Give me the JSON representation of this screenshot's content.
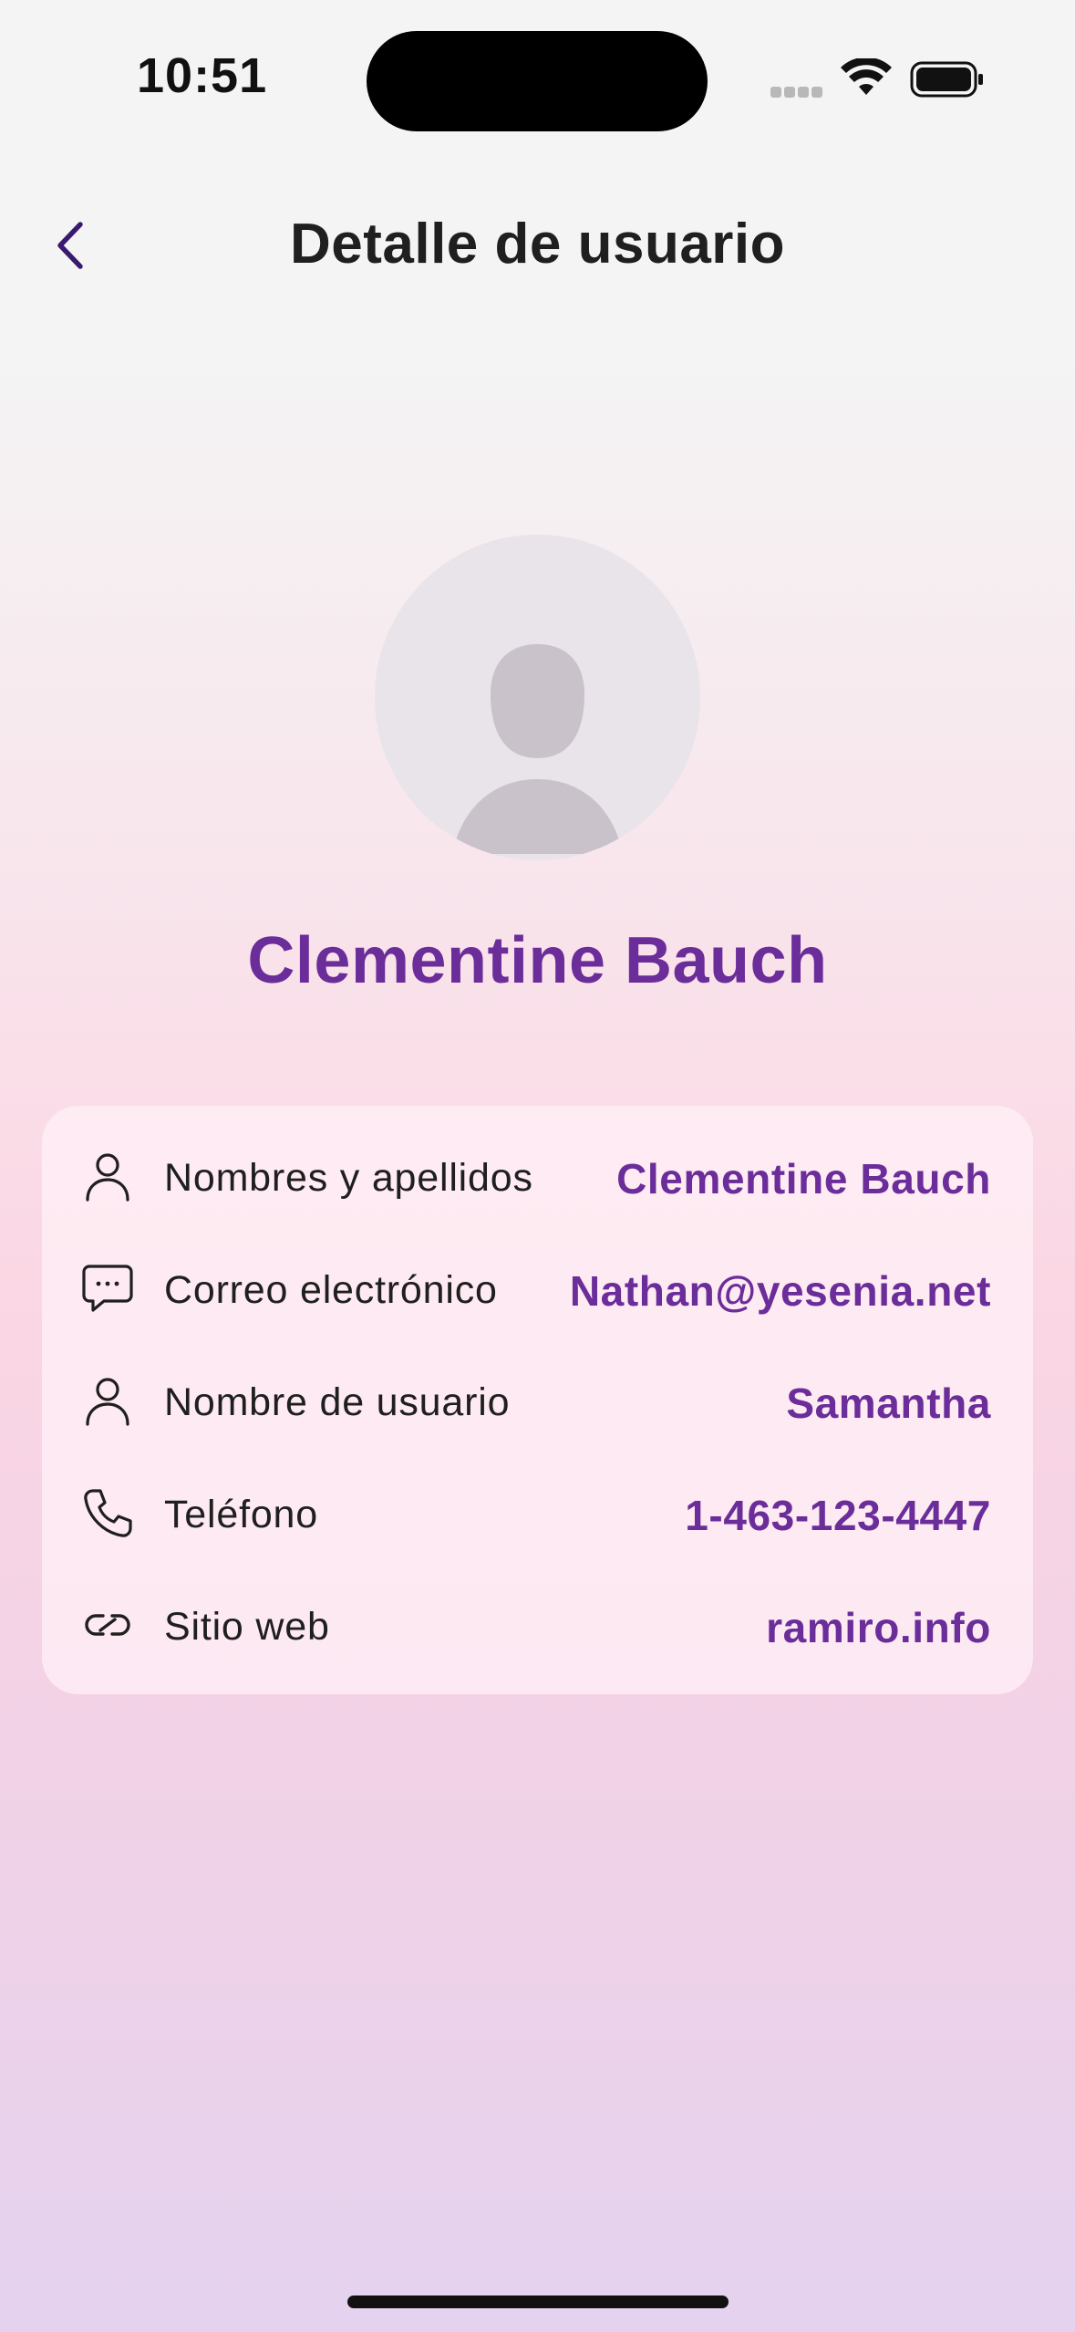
{
  "status_bar": {
    "time": "10:51",
    "icons": [
      "signal-icon",
      "wifi-icon",
      "battery-icon"
    ]
  },
  "nav": {
    "title": "Detalle de usuario",
    "back_icon": "chevron-left-icon"
  },
  "profile": {
    "name": "Clementine Bauch",
    "avatar_icon": "person-placeholder-icon"
  },
  "details": [
    {
      "icon": "person-icon",
      "label": "Nombres y apellidos",
      "value": "Clementine Bauch"
    },
    {
      "icon": "chat-bubble-icon",
      "label": "Correo electrónico",
      "value": "Nathan@yesenia.net"
    },
    {
      "icon": "person-icon",
      "label": "Nombre de usuario",
      "value": "Samantha"
    },
    {
      "icon": "phone-icon",
      "label": "Teléfono",
      "value": "1-463-123-4447"
    },
    {
      "icon": "link-icon",
      "label": "Sitio web",
      "value": "ramiro.info"
    }
  ],
  "colors": {
    "accent": "#6a2d9a",
    "back_chevron": "#3a1a6e",
    "text": "#1f1f1f"
  }
}
